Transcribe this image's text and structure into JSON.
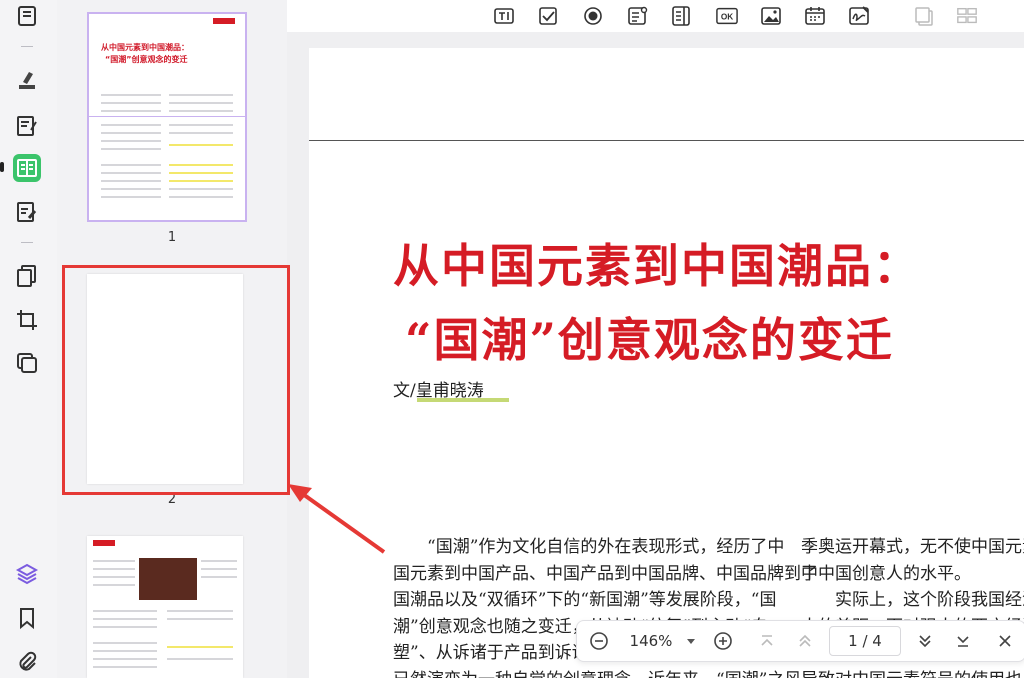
{
  "toolbar": {
    "items": [
      "thumbnail-icon",
      "highlighter-icon",
      "edit-text-icon",
      "form-icon",
      "sign-icon",
      "pages-icon",
      "crop-icon",
      "batch-icon",
      "layers-icon",
      "bookmark-icon",
      "attachment-icon"
    ]
  },
  "thumbnails": {
    "pages": [
      {
        "number": "1",
        "title_line1": "从中国元素到中国潮品：",
        "title_line2": "“国潮”创意观念的变迁"
      },
      {
        "number": "2"
      },
      {
        "number": ""
      }
    ]
  },
  "topbar": {
    "tools": [
      "text-field-icon",
      "checkbox-icon",
      "radio-button-icon",
      "combo-box-icon",
      "list-box-icon",
      "ok-button-icon",
      "image-field-icon",
      "date-field-icon",
      "signature-field-icon",
      "duplicate-icon",
      "grid-icon"
    ],
    "ok_label": "OK"
  },
  "document": {
    "title_line1": "从中国元素到中国潮品：",
    "title_line2": "“国潮”创意观念的变迁",
    "author": "文/皇甫晓涛",
    "col1": [
      "　　“国潮”作为文化自信的外在表现形式，经历了中",
      "国元素到中国产品、中国产品到中国品牌、中国品牌到中",
      "国潮品以及“双循环”下的“新国潮”等发展阶段，“国",
      "潮”创意观念也随之变迁，从被动“仿舞”到主动“自",
      "塑”、从诉诸于产品到诉诸",
      "已然演变为一种自觉的创意理念。近年来，“国潮”之风"
    ],
    "col2": [
      "季奥运开幕式，无不使中国元素",
      "了中国创意人的水平。",
      "　　实际上，这个阶段我国经济",
      "大的差距，面对强大的西方经济",
      "",
      "导致对中国元素符号的使用也比较"
    ]
  },
  "zoombar": {
    "zoom": "146%",
    "page_indicator": "1 / 4"
  },
  "colors": {
    "title_red": "#d51c25",
    "highlight_box": "#e53935",
    "active_tool": "#3bc46b"
  }
}
